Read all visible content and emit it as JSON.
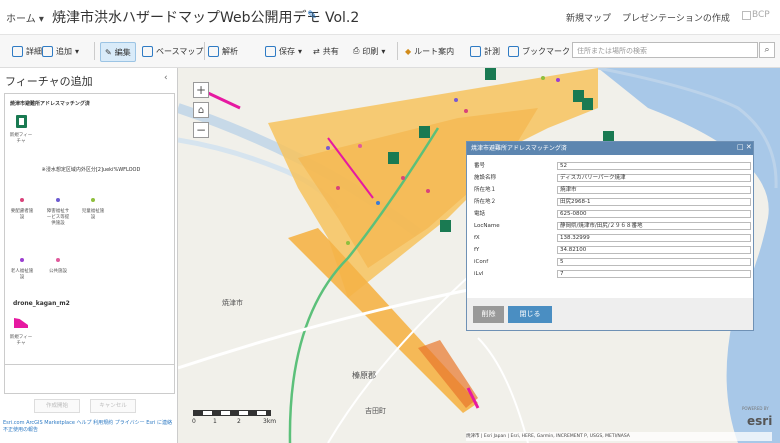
{
  "header": {
    "home": "ホーム",
    "title": "焼津市洪水ハザードマップWeb公開用デモ Vol.2",
    "new_map": "新規マップ",
    "presentation": "プレゼンテーションの作成",
    "bcp": "BCP"
  },
  "toolbar": {
    "details": "詳細",
    "add": "追加",
    "edit": "編集",
    "basemap": "ベースマップ",
    "analysis": "解析",
    "save": "保存",
    "share": "共有",
    "print": "印刷",
    "route": "ルート案内",
    "measure": "計測",
    "bookmark": "ブックマーク",
    "search_placeholder": "住所または場所の検索"
  },
  "left_panel": {
    "title": "フィーチャの追加",
    "layer1": {
      "name": "焼津市避難所アドレスマッチング済",
      "templates": [
        {
          "label": "新規フィーチャ"
        }
      ]
    },
    "layer2": {
      "name": "※浸水想定区域内外区分[2]ueki%WFLOOD",
      "templates": [
        {
          "label": "要配慮者施設",
          "color": "#d9437a"
        },
        {
          "label": "障害福祉サービス等提供施設",
          "color": "#6c5bd1"
        },
        {
          "label": "児童福祉施設",
          "color": "#8fbf3d"
        },
        {
          "label": "老人福祉施設",
          "color": "#9b3fd1"
        },
        {
          "label": "公共施設",
          "color": "#e05a9c"
        }
      ]
    },
    "layer3": {
      "name": "drone_kagan_m2",
      "templates": [
        {
          "label": "新規フィーチャ"
        }
      ]
    },
    "btn_create": "作成開始",
    "btn_cancel": "キャンセル",
    "footer": "Esri.com  ArcGIS Marketplace  ヘルプ  利用規約  プライバシー  Esri に連絡  不正使用の報告"
  },
  "map": {
    "zoom_in": "+",
    "zoom_out": "−",
    "label_city": "焼津市",
    "label_gun": "榛原郡",
    "label_town": "吉田町",
    "scale": [
      "0",
      "1",
      "2",
      "3km"
    ],
    "attribution": "焼津市 | Esri Japan | Esri, HERE, Garmin, INCREMENT P, USGS, METI/NASA",
    "esri_brand": "esri",
    "esri_powered": "POWERED BY"
  },
  "popup": {
    "title": "焼津市避難所アドレスマッチング済",
    "rows": [
      {
        "k": "番号",
        "v": "52"
      },
      {
        "k": "施設名称",
        "v": "ディスカバリーパーク焼津"
      },
      {
        "k": "所在地１",
        "v": "焼津市"
      },
      {
        "k": "所在地２",
        "v": "田尻2968-1"
      },
      {
        "k": "電話",
        "v": "625-0800"
      },
      {
        "k": "LocName",
        "v": "静岡県/焼津市/田尻/２９６８番地"
      },
      {
        "k": "fX",
        "v": "138.32999"
      },
      {
        "k": "fY",
        "v": "34.82100"
      },
      {
        "k": "iConf",
        "v": "5"
      },
      {
        "k": "iLvl",
        "v": "7"
      }
    ],
    "delete": "削除",
    "close": "閉じる"
  }
}
